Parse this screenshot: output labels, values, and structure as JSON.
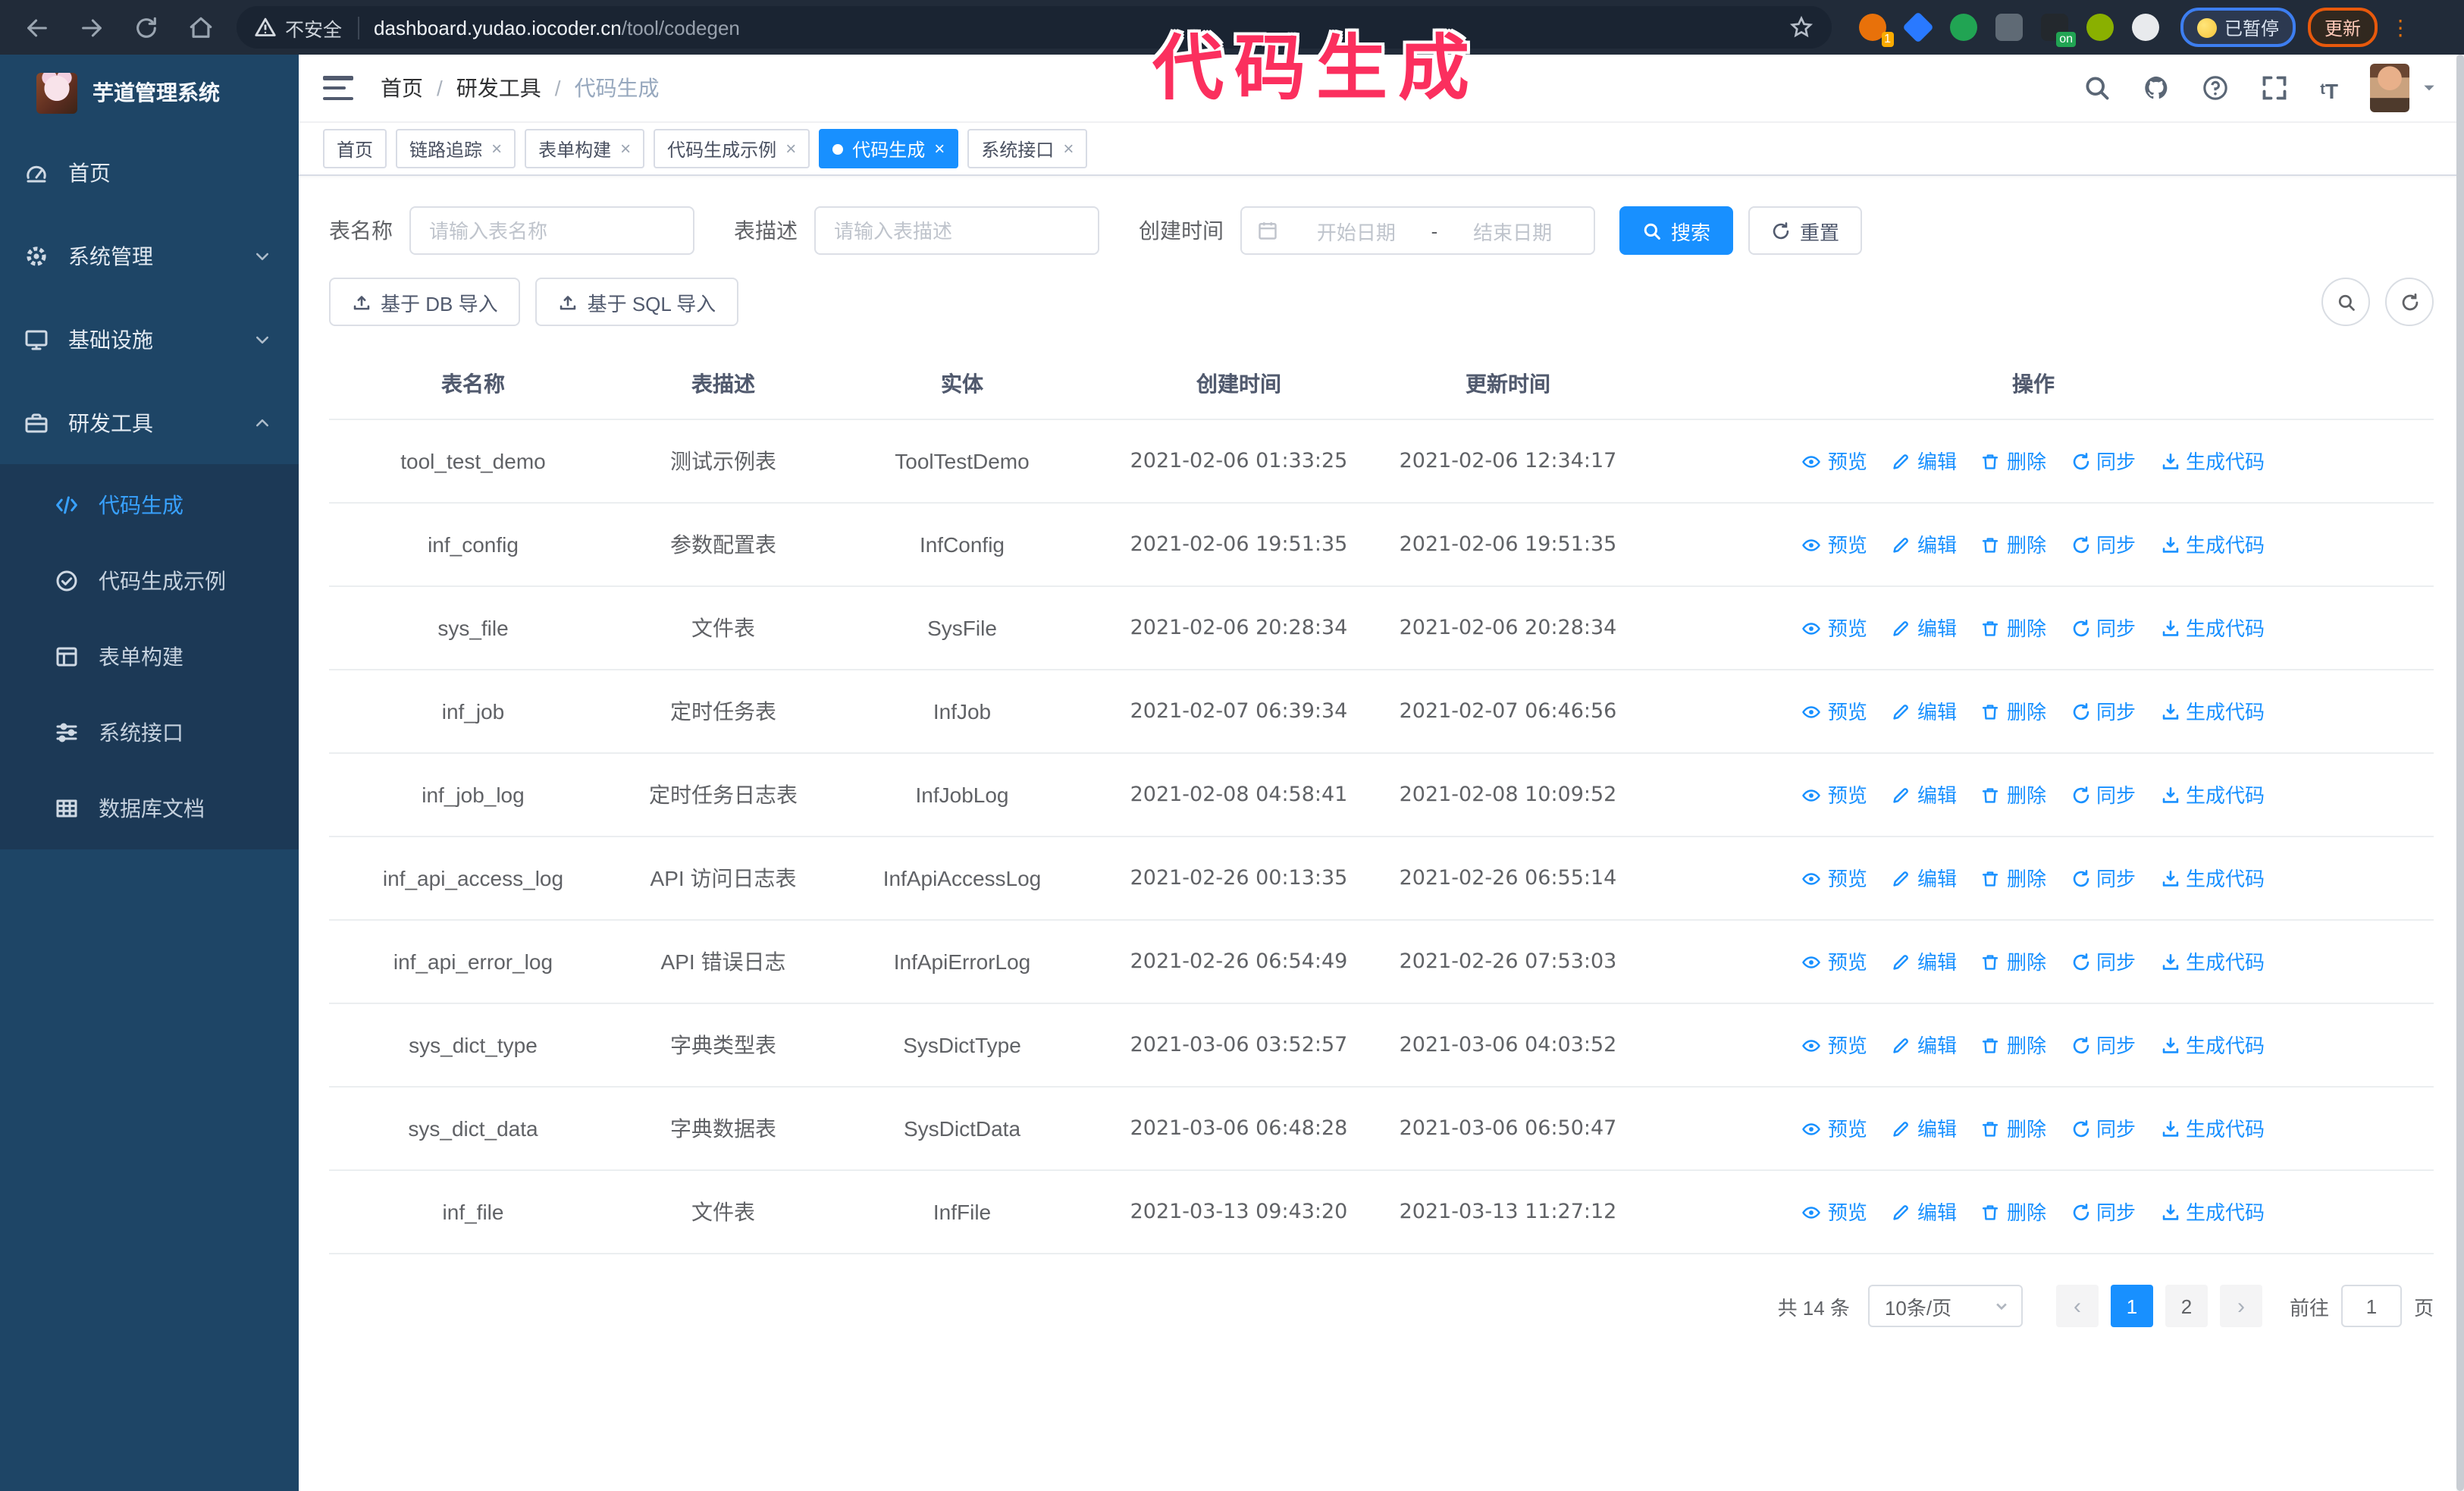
{
  "overlay_title": "代码生成",
  "colors": {
    "accent": "#1890ff",
    "annotation_pink": "#fb2f5e",
    "sidebar_bg": "#1e4566",
    "submenu_bg": "#1c3956",
    "toolbar_bg": "#212b39"
  },
  "browser": {
    "security_label": "不安全",
    "url_host": "dashboard.yudao.iocoder.cn",
    "url_path": "/tool/codegen",
    "paused_badge": "已暂停",
    "update_badge": "更新",
    "extensions": [
      {
        "name": "extension-orange",
        "shape": "circle",
        "color": "#e8710a",
        "badge": "1",
        "badge_color": "#f9ab00"
      },
      {
        "name": "extension-gem",
        "shape": "diamond",
        "color": "#2979ff",
        "badge": "",
        "badge_color": ""
      },
      {
        "name": "extension-green-check",
        "shape": "circle",
        "color": "#21a453",
        "badge": "",
        "badge_color": ""
      },
      {
        "name": "extension-grid",
        "shape": "square",
        "color": "#5f6a75",
        "badge": "",
        "badge_color": ""
      },
      {
        "name": "extension-dark-on",
        "shape": "square",
        "color": "#23282d",
        "badge": "on",
        "badge_color": "#21a453"
      },
      {
        "name": "extension-robot",
        "shape": "circle",
        "color": "#8ab000",
        "badge": "",
        "badge_color": ""
      },
      {
        "name": "extension-puzzle",
        "shape": "circle",
        "color": "#e8eaed",
        "badge": "",
        "badge_color": ""
      }
    ]
  },
  "sidebar": {
    "app_title": "芋道管理系统",
    "menu": [
      {
        "label": "首页",
        "icon": "dashboard-icon",
        "expandable": false,
        "state": ""
      },
      {
        "label": "系统管理",
        "icon": "gear-icon",
        "expandable": true,
        "state": "collapsed"
      },
      {
        "label": "基础设施",
        "icon": "monitor-icon",
        "expandable": true,
        "state": "collapsed"
      },
      {
        "label": "研发工具",
        "icon": "toolbox-icon",
        "expandable": true,
        "state": "expanded"
      }
    ],
    "submenu": [
      {
        "label": "代码生成",
        "icon": "code-icon",
        "active": true
      },
      {
        "label": "代码生成示例",
        "icon": "example-icon",
        "active": false
      },
      {
        "label": "表单构建",
        "icon": "form-icon",
        "active": false
      },
      {
        "label": "系统接口",
        "icon": "api-icon",
        "active": false
      },
      {
        "label": "数据库文档",
        "icon": "database-icon",
        "active": false
      }
    ]
  },
  "header": {
    "breadcrumb": [
      "首页",
      "研发工具",
      "代码生成"
    ]
  },
  "tabs": [
    {
      "label": "首页",
      "closable": false,
      "active": false
    },
    {
      "label": "链路追踪",
      "closable": true,
      "active": false
    },
    {
      "label": "表单构建",
      "closable": true,
      "active": false
    },
    {
      "label": "代码生成示例",
      "closable": true,
      "active": false
    },
    {
      "label": "代码生成",
      "closable": true,
      "active": true
    },
    {
      "label": "系统接口",
      "closable": true,
      "active": false
    }
  ],
  "search": {
    "name_label": "表名称",
    "name_placeholder": "请输入表名称",
    "desc_label": "表描述",
    "desc_placeholder": "请输入表描述",
    "time_label": "创建时间",
    "start_placeholder": "开始日期",
    "range_separator": "-",
    "end_placeholder": "结束日期",
    "search_button": "搜索",
    "reset_button": "重置"
  },
  "toolbar": {
    "import_db_button": "基于 DB 导入",
    "import_sql_button": "基于 SQL 导入"
  },
  "table": {
    "columns": [
      "表名称",
      "表描述",
      "实体",
      "创建时间",
      "更新时间",
      "操作"
    ],
    "actions": [
      "预览",
      "编辑",
      "删除",
      "同步",
      "生成代码"
    ],
    "rows": [
      {
        "name": "tool_test_demo",
        "desc": "测试示例表",
        "entity": "ToolTestDemo",
        "created": "2021-02-06 01:33:25",
        "updated": "2021-02-06 12:34:17",
        "created_wrap": false,
        "updated_wrap": false
      },
      {
        "name": "inf_config",
        "desc": "参数配置表",
        "entity": "InfConfig",
        "created": "2021-02-06 19:51:35",
        "updated": "2021-02-06 19:51:35",
        "created_wrap": false,
        "updated_wrap": false
      },
      {
        "name": "sys_file",
        "desc": "文件表",
        "entity": "SysFile",
        "created": "2021-02-06 20:28:34",
        "updated": "2021-02-06 20:28:34",
        "created_wrap": true,
        "updated_wrap": true
      },
      {
        "name": "inf_job",
        "desc": "定时任务表",
        "entity": "InfJob",
        "created": "2021-02-07 06:39:34",
        "updated": "2021-02-07 06:46:56",
        "created_wrap": true,
        "updated_wrap": true
      },
      {
        "name": "inf_job_log",
        "desc": "定时任务日志表",
        "entity": "InfJobLog",
        "created": "2021-02-08 04:58:41",
        "updated": "2021-02-08 10:09:52",
        "created_wrap": true,
        "updated_wrap": true
      },
      {
        "name": "inf_api_access_log",
        "desc": "API 访问日志表",
        "entity": "InfApiAccessLog",
        "created": "2021-02-26 00:13:35",
        "updated": "2021-02-26 06:55:14",
        "created_wrap": false,
        "updated_wrap": true
      },
      {
        "name": "inf_api_error_log",
        "desc": "API 错误日志",
        "entity": "InfApiErrorLog",
        "created": "2021-02-26 06:54:49",
        "updated": "2021-02-26 07:53:03",
        "created_wrap": true,
        "updated_wrap": true
      },
      {
        "name": "sys_dict_type",
        "desc": "字典类型表",
        "entity": "SysDictType",
        "created": "2021-03-06 03:52:57",
        "updated": "2021-03-06 04:03:52",
        "created_wrap": true,
        "updated_wrap": true
      },
      {
        "name": "sys_dict_data",
        "desc": "字典数据表",
        "entity": "SysDictData",
        "created": "2021-03-06 06:48:28",
        "updated": "2021-03-06 06:50:47",
        "created_wrap": true,
        "updated_wrap": true
      },
      {
        "name": "inf_file",
        "desc": "文件表",
        "entity": "InfFile",
        "created": "2021-03-13 09:43:20",
        "updated": "2021-03-13 11:27:12",
        "created_wrap": true,
        "updated_wrap": false
      }
    ]
  },
  "pagination": {
    "total_text": "共 14 条",
    "page_size": "10条/页",
    "prev_label": "‹",
    "next_label": "›",
    "pages": [
      "1",
      "2"
    ],
    "active_page": "1",
    "goto_label": "前往",
    "goto_value": "1",
    "goto_suffix": "页"
  }
}
